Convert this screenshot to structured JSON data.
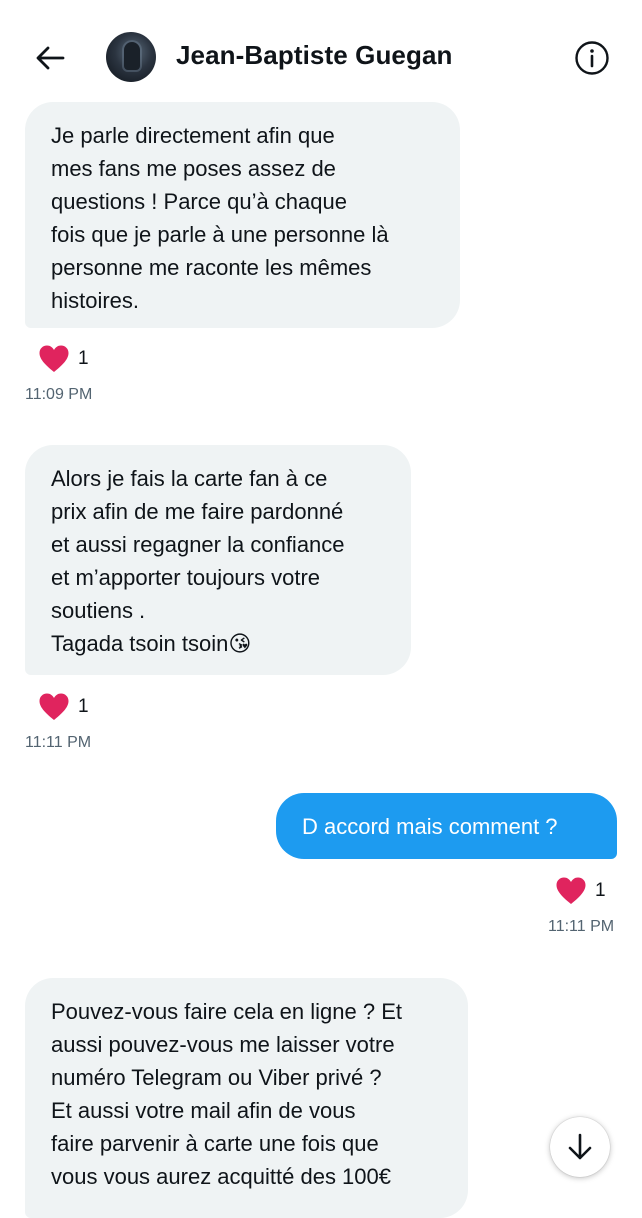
{
  "header": {
    "title": "Jean-Baptiste Guegan",
    "back_icon": "arrow-left-icon",
    "info_icon": "info-circle-icon"
  },
  "messages": [
    {
      "direction": "incoming",
      "text": "Je parle directement afin que\nmes fans me poses assez de\nquestions ! Parce qu’à chaque\nfois que je parle à une personne là\npersonne me raconte les mêmes\nhistoires.",
      "reaction_count": "1",
      "time": "11:09 PM"
    },
    {
      "direction": "incoming",
      "text": "Alors je fais la carte fan à ce\nprix afin de me faire pardonné\net aussi regagner la confiance\net m’apporter toujours votre\nsoutiens .\nTagada tsoin tsoin😘",
      "reaction_count": "1",
      "time": "11:11 PM"
    },
    {
      "direction": "outgoing",
      "text": "D accord mais comment ?",
      "reaction_count": "1",
      "time": "11:11 PM"
    },
    {
      "direction": "incoming",
      "text": "Pouvez-vous faire cela en ligne ? Et\naussi pouvez-vous me laisser votre\nnuméro Telegram ou Viber privé ?\nEt aussi votre mail afin de vous\nfaire parvenir à carte une fois que\nvous vous aurez acquitté des 100€"
    }
  ],
  "colors": {
    "outgoing_bubble": "#1d9bf0",
    "incoming_bubble": "#eff3f4",
    "heart": "#e0245e",
    "timestamp": "#536471"
  },
  "scroll_button": {
    "icon": "arrow-down-icon"
  }
}
